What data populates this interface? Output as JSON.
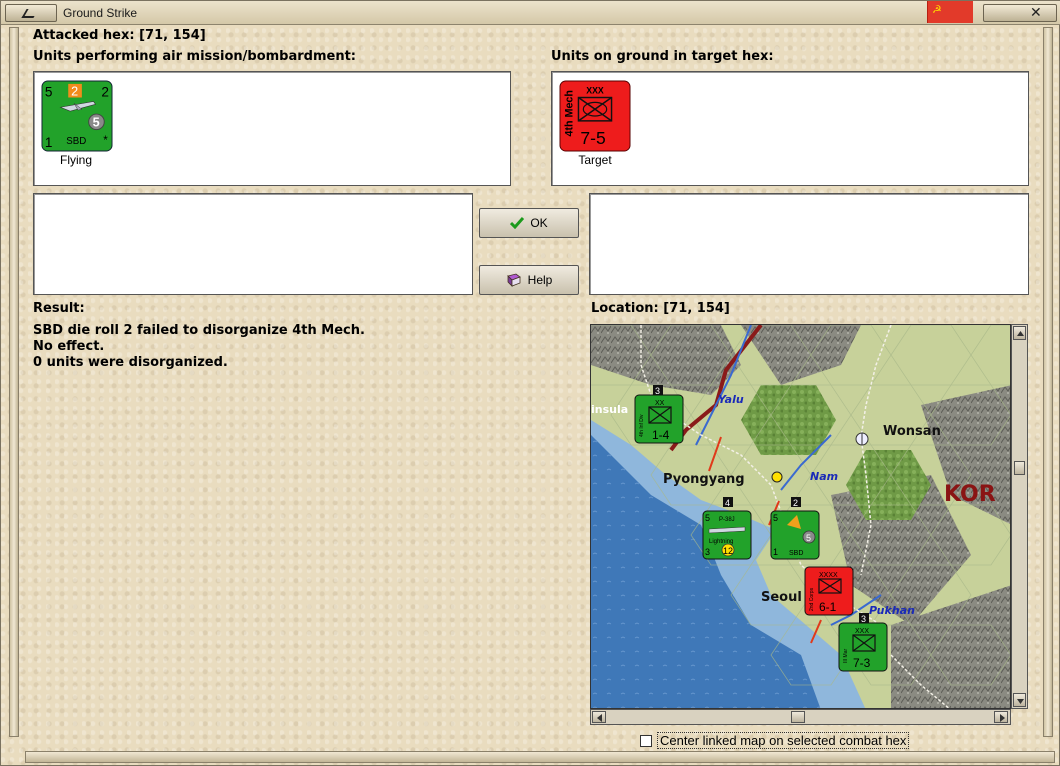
{
  "window": {
    "title": "Ground Strike"
  },
  "attacked_hex": {
    "label": "Attacked hex:",
    "value": "[71, 154]"
  },
  "air_units": {
    "heading": "Units performing air mission/bombardment:",
    "units": [
      {
        "name": "SBD",
        "top_left": "5",
        "top_mid": "2",
        "top_right": "2",
        "circle": "5",
        "bottom_left": "1",
        "bottom_right": "*",
        "caption": "Flying",
        "color": "#22a22a"
      }
    ]
  },
  "ground_units": {
    "heading": "Units on ground in target hex:",
    "units": [
      {
        "name": "4th Mech",
        "size": "XXX",
        "strength": "7-5",
        "caption": "Target",
        "color": "#ee1c1c"
      }
    ]
  },
  "buttons": {
    "ok": "OK",
    "help": "Help"
  },
  "result": {
    "heading": "Result:",
    "lines": [
      "SBD die roll 2 failed to disorganize 4th Mech.",
      "No effect.",
      "0 units were disorganized."
    ]
  },
  "location": {
    "label": "Location:",
    "value": "[71, 154]"
  },
  "map": {
    "labels": {
      "pyongyang": "Pyongyang",
      "wonsan": "Wonsan",
      "seoul": "Seoul",
      "kor": "KOR",
      "insula": "insula",
      "yalu": "Yalu",
      "nam": "Nam",
      "pukhan": "Pukhan"
    },
    "units": {
      "u1": {
        "stack": "3",
        "name": "4th Inf Div",
        "size": "XX",
        "strength": "1-4"
      },
      "u2": {
        "stack": "4",
        "name": "P-38J",
        "subname": "Lightning",
        "a": "5",
        "b": "3",
        "c": "12"
      },
      "u3": {
        "stack": "2",
        "name": "SBD",
        "a": "5",
        "b": "1",
        "c": "5"
      },
      "u4": {
        "name": "2nd Corps",
        "size": "XXXX",
        "strength": "6-1"
      },
      "u5": {
        "stack": "3",
        "name": "III Mar",
        "size": "XXX",
        "strength": "7-3"
      }
    },
    "colors": {
      "sea": "#3f78b8",
      "coast": "#9cc0e0",
      "land": "#c8d39a",
      "forest": "#7aa04f",
      "mountain": "#8a8a80",
      "green_unit": "#22a22a",
      "red_unit": "#ee1c1c"
    }
  },
  "center_option": {
    "label": "Center linked map on selected combat hex",
    "checked": false
  }
}
